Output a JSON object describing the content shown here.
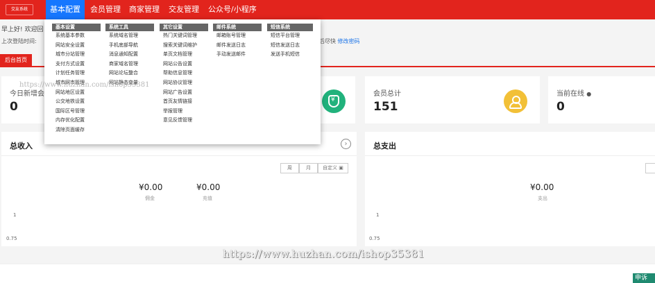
{
  "header": {
    "logo": "交友系统",
    "nav": [
      "基本配置",
      "会员管理",
      "商家管理",
      "交友管理",
      "公众号/小程序"
    ],
    "active_index": 0
  },
  "info": {
    "greeting": "早上好! 欢迎回",
    "last_login": "上次登陆时间: ",
    "tip_prefix": "后尽快",
    "change_password": "修改密码"
  },
  "tab": {
    "label": "后台首页"
  },
  "stats": [
    {
      "label": "今日新增会",
      "value": "0"
    },
    {
      "label": "会员总计",
      "value": "151"
    },
    {
      "label": "当前在线",
      "value": "0"
    }
  ],
  "panels": {
    "income_title": "总收入",
    "expense_title": "总支出",
    "segs": [
      "周",
      "月",
      "自定义"
    ],
    "income": [
      {
        "amount": "¥0.00",
        "label": "佣金"
      },
      {
        "amount": "¥0.00",
        "label": "充值"
      }
    ],
    "expense": [
      {
        "amount": "¥0.00",
        "label": "支出"
      }
    ],
    "axis": [
      "1",
      "0.75"
    ]
  },
  "menu": {
    "columns": [
      {
        "title": "基本设置",
        "items": [
          "系统基本参数",
          "网站安全设置",
          "城市分站管理",
          "支付方式设置",
          "计划任务管理",
          "城市网市管理",
          "网站地区设置",
          "公交地铁设置",
          "国际区号管理",
          "内存优化配置",
          "清除页面缓存"
        ]
      },
      {
        "title": "系统工具",
        "items": [
          "系统域名管理",
          "手机底部导航",
          "消息通知配置",
          "商家域名管理",
          "网站论坛整合",
          "网站静态变量"
        ]
      },
      {
        "title": "其它设置",
        "items": [
          "热门关键词管理",
          "搜索关键词维护",
          "单页文档管理",
          "网站公告设置",
          "帮助信息管理",
          "网站协议管理",
          "网站广告设置",
          "首页友情链接",
          "举报管理",
          "意见反馈管理"
        ]
      },
      {
        "title": "邮件系统",
        "items": [
          "邮箱账号管理",
          "邮件发送日志",
          "手动发送邮件"
        ]
      },
      {
        "title": "短信系统",
        "items": [
          "短信平台管理",
          "短信发送日志",
          "发送手机短信"
        ]
      }
    ]
  },
  "watermark": "https://www.huzhan.com/ishop35381",
  "watermark_small": "https://www.huzhan.com/ishop35381",
  "report_label": "申诉",
  "colors": {
    "brand": "#e2241d",
    "active_nav": "#1677ff",
    "money_badge": "#21b27c",
    "user_badge": "#f2c037"
  }
}
